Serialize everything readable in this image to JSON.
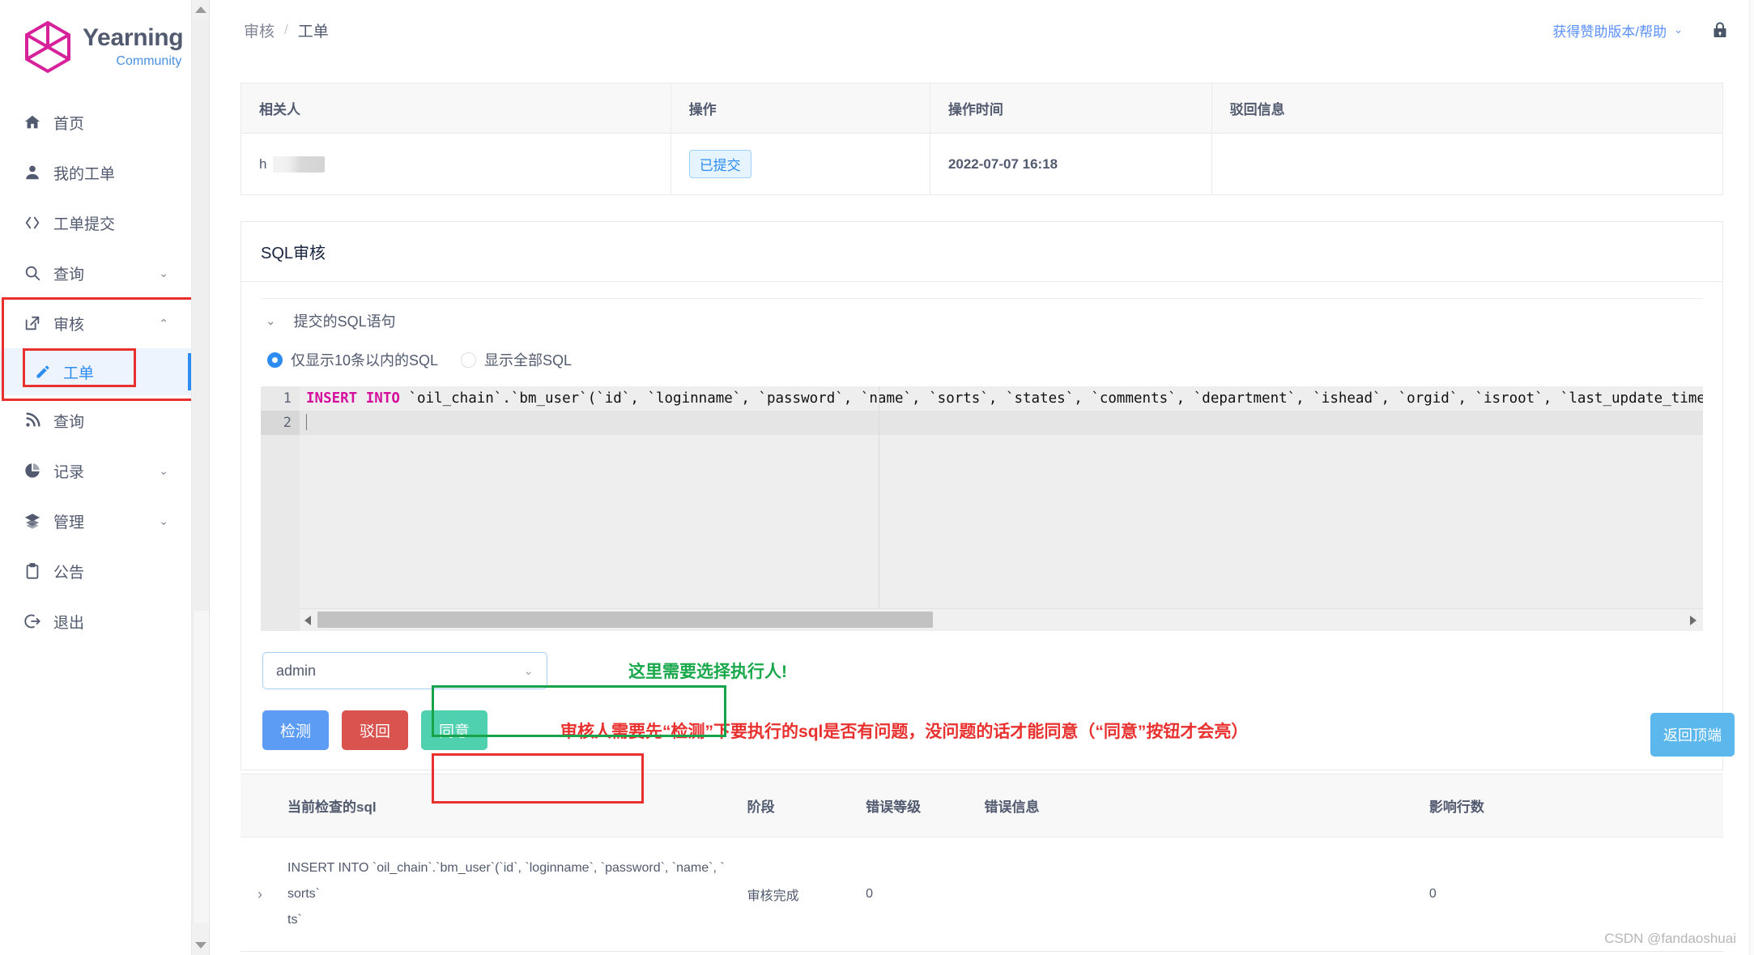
{
  "sidebar": {
    "brand": {
      "title": "Yearning",
      "subtitle": "Community",
      "logo_icon": "hexagon-cube-logo"
    },
    "items": [
      {
        "label": "首页",
        "icon": "home-icon",
        "chevron": ""
      },
      {
        "label": "我的工单",
        "icon": "user-icon",
        "chevron": ""
      },
      {
        "label": "工单提交",
        "icon": "code-brackets-icon",
        "chevron": ""
      },
      {
        "label": "查询",
        "icon": "search-icon",
        "chevron": "⌄"
      },
      {
        "label": "审核",
        "icon": "external-link-icon",
        "chevron": "⌃"
      },
      {
        "label": "查询",
        "icon": "rss-icon",
        "chevron": ""
      },
      {
        "label": "记录",
        "icon": "pie-chart-icon",
        "chevron": "⌄"
      },
      {
        "label": "管理",
        "icon": "layers-icon",
        "chevron": "⌄"
      },
      {
        "label": "公告",
        "icon": "clipboard-icon",
        "chevron": ""
      },
      {
        "label": "退出",
        "icon": "logout-icon",
        "chevron": ""
      }
    ],
    "active_sub": {
      "label": "工单",
      "icon": "pencil-icon"
    }
  },
  "topbar": {
    "breadcrumb": {
      "parent": "审核",
      "separator": "/",
      "current": "工单"
    },
    "sponsor_link": "获得赞助版本/帮助",
    "sponsor_chevron": "⌄",
    "lock_icon": "lock-icon"
  },
  "history_table": {
    "headers": [
      "相关人",
      "操作",
      "操作时间",
      "驳回信息"
    ],
    "rows": [
      {
        "person_prefix": "h",
        "person_masked": true,
        "action": "已提交",
        "time": "2022-07-07 16:18",
        "reject_info": ""
      }
    ]
  },
  "sql_panel": {
    "title": "SQL审核",
    "collapse_label": "提交的SQL语句",
    "collapse_chevron": "⌄",
    "radios": [
      {
        "label": "仅显示10条以内的SQL",
        "selected": true
      },
      {
        "label": "显示全部SQL",
        "selected": false
      }
    ],
    "editor": {
      "line_numbers": [
        "1",
        "2"
      ],
      "line1_keyword": "INSERT INTO",
      "line1_rest": " `oil_chain`.`bm_user`(`id`, `loginname`, `password`, `name`, `sorts`, `states`, `comments`, `department`, `ishead`, `orgid`, `isroot`, `last_update_time`, `ph",
      "line2": ""
    },
    "executor_select": {
      "value": "admin",
      "chevron": "⌄"
    },
    "buttons": {
      "check": "检测",
      "reject": "驳回",
      "agree": "同意"
    }
  },
  "annotations": {
    "select_note": "这里需要选择执行人!",
    "buttons_note": "审核人需要先“检测”下要执行的sql是否有问题，没问题的话才能同意（“同意”按钮才会亮）"
  },
  "back_to_top": "返回顶端",
  "result_table": {
    "headers": [
      "当前检查的sql",
      "阶段",
      "错误等级",
      "错误信息",
      "影响行数"
    ],
    "rows": [
      {
        "expander": "›",
        "sql": "INSERT INTO `oil_chain`.`bm_user`(`id`, `loginname`, `password`, `name`, `sorts`",
        "sql_tail": "ts`",
        "stage": "审核完成",
        "error_level": "0",
        "error_msg": "",
        "affected_rows": "0"
      }
    ]
  },
  "watermark": "CSDN @fandaoshuai",
  "colors": {
    "brand_magenta": "#d6219a",
    "accent_blue": "#2d8cf0",
    "annotation_red": "#e8312f",
    "annotation_green": "#19a84c",
    "btn_check": "#5c9cf5",
    "btn_reject": "#d9534f",
    "btn_agree": "#4fd1b0",
    "back_top": "#5cb8ec",
    "sql_keyword": "#d40f9c"
  }
}
